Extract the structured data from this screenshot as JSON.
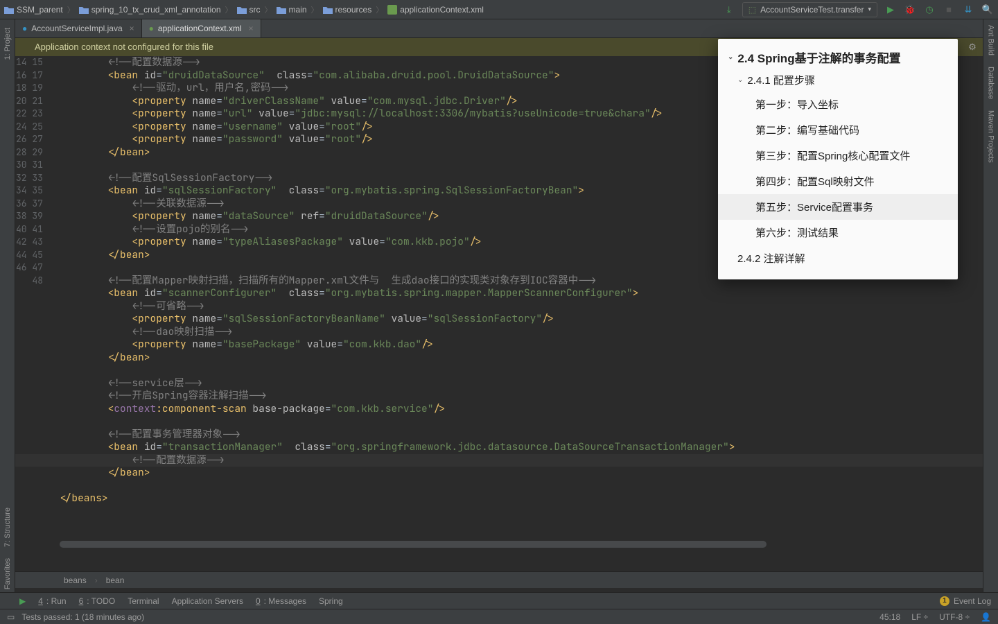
{
  "breadcrumbs": [
    "SSM_parent",
    "spring_10_tx_crud_xml_annotation",
    "src",
    "main",
    "resources",
    "applicationContext.xml"
  ],
  "run_config": "AccountServiceTest.transfer",
  "tabs": [
    {
      "label": "AccountServiceImpl.java",
      "active": false
    },
    {
      "label": "applicationContext.xml",
      "active": true
    }
  ],
  "banner": "Application context not configured for this file",
  "left_tools": [
    "1: Project",
    "7: Structure",
    "2: Favorites"
  ],
  "right_tools": [
    "Ant Build",
    "Database",
    "Maven Projects"
  ],
  "editor": {
    "first_line": 14,
    "highlight_line": 45,
    "caret": {
      "line": 45,
      "col": 18
    },
    "lines": [
      {
        "t": "cm",
        "text": "        <!--配置数据源-->"
      },
      {
        "t": "bean",
        "id": "druidDataSource",
        "cls": "com.alibaba.druid.pool.DruidDataSource"
      },
      {
        "t": "cm",
        "text": "            <!--驱动，url，用户名,密码-->"
      },
      {
        "t": "prop",
        "name": "driverClassName",
        "value": "com.mysql.jdbc.Driver"
      },
      {
        "t": "prop",
        "name": "url",
        "value": "jdbc:mysql://localhost:3306/mybatis?useUnicode=true&chara"
      },
      {
        "t": "prop",
        "name": "username",
        "value": "root"
      },
      {
        "t": "prop",
        "name": "password",
        "value": "root"
      },
      {
        "t": "end",
        "text": "        </bean>"
      },
      {
        "t": "blank"
      },
      {
        "t": "cm",
        "text": "        <!--配置SqlSessionFactory-->"
      },
      {
        "t": "bean",
        "id": "sqlSessionFactory",
        "cls": "org.mybatis.spring.SqlSessionFactoryBean"
      },
      {
        "t": "cm",
        "text": "            <!--关联数据源-->"
      },
      {
        "t": "propref",
        "name": "dataSource",
        "ref": "druidDataSource"
      },
      {
        "t": "cm",
        "text": "            <!--设置pojo的别名-->"
      },
      {
        "t": "prop",
        "name": "typeAliasesPackage",
        "value": "com.kkb.pojo"
      },
      {
        "t": "end",
        "text": "        </bean>"
      },
      {
        "t": "blank"
      },
      {
        "t": "cm",
        "text": "        <!--配置Mapper映射扫描，扫描所有的Mapper.xml文件与  生成dao接口的实现类对象存到IOC容器中-->"
      },
      {
        "t": "bean",
        "id": "scannerConfigurer",
        "cls": "org.mybatis.spring.mapper.MapperScannerConfigurer"
      },
      {
        "t": "cm",
        "text": "            <!--可省略-->"
      },
      {
        "t": "prop",
        "name": "sqlSessionFactoryBeanName",
        "value": "sqlSessionFactory"
      },
      {
        "t": "cm",
        "text": "            <!--dao映射扫描-->"
      },
      {
        "t": "prop",
        "name": "basePackage",
        "value": "com.kkb.dao"
      },
      {
        "t": "end",
        "text": "        </bean>"
      },
      {
        "t": "blank"
      },
      {
        "t": "cm",
        "text": "        <!--service层-->"
      },
      {
        "t": "cm",
        "text": "        <!--开启Spring容器注解扫描-->"
      },
      {
        "t": "scan",
        "pkg": "com.kkb.service"
      },
      {
        "t": "blank"
      },
      {
        "t": "cm",
        "text": "        <!--配置事务管理器对象-->"
      },
      {
        "t": "bean",
        "id": "transactionManager",
        "cls": "org.springframework.jdbc.datasource.DataSourceTransactionManager"
      },
      {
        "t": "cm",
        "text": "            <!--配置数据源-->"
      },
      {
        "t": "end",
        "text": "        </bean>"
      },
      {
        "t": "blank"
      },
      {
        "t": "endbeans"
      }
    ],
    "crumbs": [
      "beans",
      "bean"
    ]
  },
  "outline": {
    "title": "2.4 Spring基于注解的事务配置",
    "section": "2.4.1 配置步骤",
    "items": [
      "第一步：导入坐标",
      "第二步：编写基础代码",
      "第三步：配置Spring核心配置文件",
      "第四步：配置Sql映射文件",
      "第五步：Service配置事务",
      "第六步：测试结果"
    ],
    "selected": 4,
    "section2": "2.4.2 注解详解"
  },
  "bottom_tools": [
    {
      "k": "4",
      "l": "Run"
    },
    {
      "k": "6",
      "l": "TODO"
    },
    {
      "k": "",
      "l": "Terminal"
    },
    {
      "k": "",
      "l": "Application Servers"
    },
    {
      "k": "0",
      "l": "Messages"
    },
    {
      "k": "",
      "l": "Spring"
    }
  ],
  "event_log": {
    "count": "1",
    "label": "Event Log"
  },
  "status": {
    "msg": "Tests passed: 1 (18 minutes ago)",
    "pos": "45:18",
    "sep": "LF ÷",
    "enc": "UTF-8 ÷"
  }
}
